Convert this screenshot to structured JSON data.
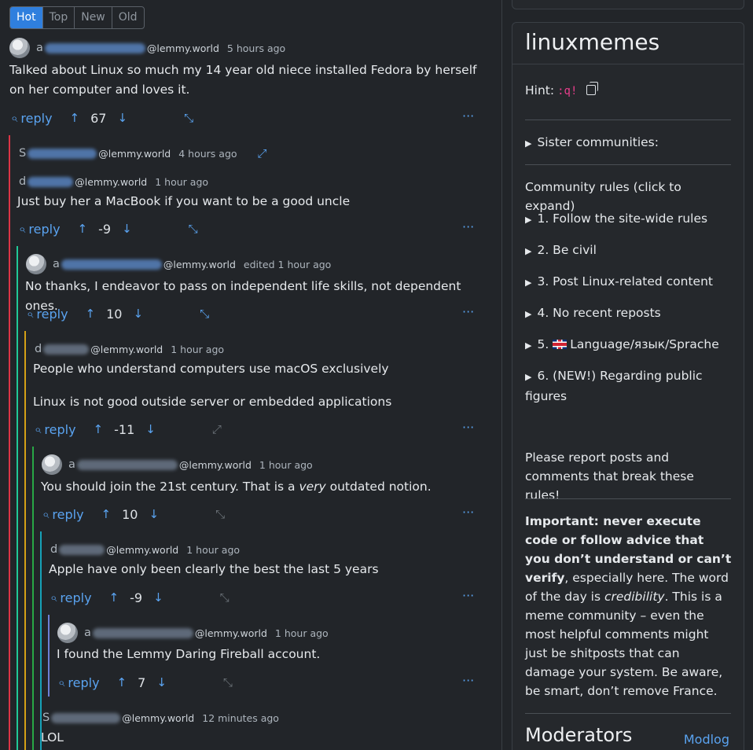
{
  "sort_tabs": [
    {
      "label": "Hot",
      "active": true
    },
    {
      "label": "Top",
      "active": false
    },
    {
      "label": "New",
      "active": false
    },
    {
      "label": "Old",
      "active": false
    }
  ],
  "action_labels": {
    "reply": "reply",
    "upvote_icon": "↑",
    "downvote_icon": "↓",
    "collapse_icon": "⤡",
    "more_icon": "···"
  },
  "comments": [
    {
      "initial": "a",
      "domain": "@lemmy.world",
      "edited": "",
      "time": "5 hours ago",
      "paragraphs": [
        "Talked about Linux so much my 14 year old niece installed Fedora by herself on her computer and loves it."
      ],
      "score": "67",
      "has_avatar": true
    },
    {
      "initial": "S",
      "domain": "@lemmy.world",
      "edited": "",
      "time": "4 hours ago",
      "collapsed": true
    },
    {
      "initial": "d",
      "domain": "@lemmy.world",
      "edited": "",
      "time": "1 hour ago",
      "paragraphs": [
        "Just buy her a MacBook if you want to be a good uncle"
      ],
      "score": "-9"
    },
    {
      "initial": "a",
      "domain": "@lemmy.world",
      "edited": "edited",
      "time": "1 hour ago",
      "paragraphs": [
        "No thanks, I endeavor to pass on independent life skills, not dependent ones."
      ],
      "score": "10",
      "has_avatar": true
    },
    {
      "initial": "d",
      "domain": "@lemmy.world",
      "edited": "",
      "time": "1 hour ago",
      "paragraphs": [
        "People who understand computers use macOS exclusively",
        "Linux is not good outside server or embedded applications"
      ],
      "score": "-11"
    },
    {
      "initial": "a",
      "domain": "@lemmy.world",
      "edited": "",
      "time": "1 hour ago",
      "paragraph_pre": "You should join the 21st century. That is a ",
      "paragraph_em": "very",
      "paragraph_post": " outdated notion.",
      "score": "10",
      "has_avatar": true
    },
    {
      "initial": "d",
      "domain": "@lemmy.world",
      "edited": "",
      "time": "1 hour ago",
      "paragraphs": [
        "Apple have only been clearly the best the last 5 years"
      ],
      "score": "-9"
    },
    {
      "initial": "a",
      "domain": "@lemmy.world",
      "edited": "",
      "time": "1 hour ago",
      "paragraphs": [
        "I found the Lemmy Daring Fireball account."
      ],
      "score": "7",
      "has_avatar": true
    },
    {
      "initial": "S",
      "domain": "@lemmy.world",
      "edited": "",
      "time": "12 minutes ago",
      "paragraphs": [
        "LOL"
      ]
    }
  ],
  "thread_colors": [
    "#dc3545",
    "#20c997",
    "#6f42c1",
    "#fd7e14",
    "#28a745",
    "#17a2b8",
    "#6c7fd6",
    "#198754"
  ],
  "sidebar": {
    "title": "linuxmemes",
    "hint_label": "Hint:",
    "hint_code": ":q!",
    "sister_communities": "Sister communities:",
    "rules_heading": "Community rules (click to expand)",
    "rules": [
      "1. Follow the site-wide rules",
      "2. Be civil",
      "3. Post Linux-related content",
      "4. No recent reposts",
      "Language/язык/Sprache",
      "6. (NEW!) Regarding public figures"
    ],
    "rule5_prefix": "5.",
    "report_notice": "Please report posts and comments that break these rules!",
    "important_bold": "Important: never execute code or follow advice that you don’t understand or can’t verify",
    "important_rest_1": ", especially here. The word of the day is ",
    "important_em": "credibility",
    "important_rest_2": ". This is a meme community – even the most helpful comments might just be shitposts that can damage your system. Be aware, be smart, don’t remove France.",
    "moderators": "Moderators",
    "modlog": "Modlog"
  }
}
